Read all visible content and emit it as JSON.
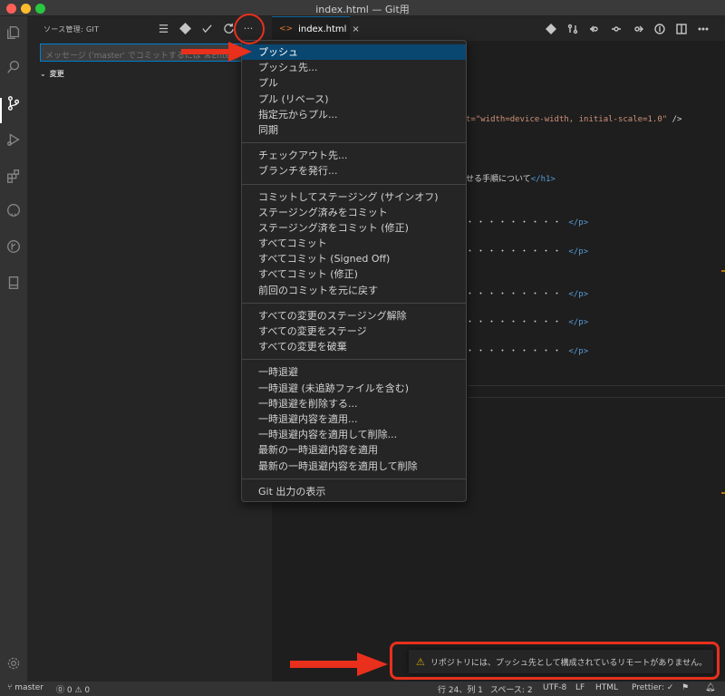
{
  "window": {
    "title": "index.html — Git用"
  },
  "sidebar": {
    "header": "ソース管理: GIT",
    "commit_placeholder": "メッセージ ('master' でコミットするには ⌘Enter)",
    "changes_label": "変更",
    "tool_more": "···"
  },
  "editor": {
    "tab": {
      "label": "index.html",
      "icon": "<>",
      "close": "×"
    },
    "code_lines": [
      {
        "type": "attr",
        "text": "t=\"width=device-width, initial-scale=1.0\"",
        "tail": " />"
      },
      {
        "type": "text",
        "text": "せる手順について",
        "tail": "</h1>"
      },
      {
        "type": "dots",
        "text": "・・・・・・・・・",
        "tail": " </p>"
      },
      {
        "type": "dots",
        "text": "・・・・・・・・・",
        "tail": " </p>"
      },
      {
        "type": "dots",
        "text": "・・・・・・・・・",
        "tail": " </p>"
      },
      {
        "type": "dots",
        "text": "・・・・・・・・・",
        "tail": " </p>"
      },
      {
        "type": "dots",
        "text": "・・・・・・・・・",
        "tail": " </p>"
      }
    ]
  },
  "menu": {
    "groups": [
      [
        "プッシュ",
        "プッシュ先...",
        "プル",
        "プル (リベース)",
        "指定元からプル...",
        "同期"
      ],
      [
        "チェックアウト先...",
        "ブランチを発行..."
      ],
      [
        "コミットしてステージング (サインオフ)",
        "ステージング済みをコミット",
        "ステージング済をコミット (修正)",
        "すべてコミット",
        "すべてコミット (Signed Off)",
        "すべてコミット (修正)",
        "前回のコミットを元に戻す"
      ],
      [
        "すべての変更のステージング解除",
        "すべての変更をステージ",
        "すべての変更を破棄"
      ],
      [
        "一時退避",
        "一時退避 (未追跡ファイルを含む)",
        "一時退避を削除する...",
        "一時退避内容を適用...",
        "一時退避内容を適用して削除...",
        "最新の一時退避内容を適用",
        "最新の一時退避内容を適用して削除"
      ],
      [
        "Git 出力の表示"
      ]
    ],
    "highlighted": "プッシュ"
  },
  "notification": {
    "icon": "warning-icon",
    "text": "リポジトリには、プッシュ先として構成されているリモートがありません。"
  },
  "statusbar": {
    "branch": "master",
    "problems": "⓪ 0 ⚠ 0",
    "position": "行 24、列 1",
    "spaces": "スペース: 2",
    "encoding": "UTF-8",
    "eol": "LF",
    "language": "HTML",
    "prettier": "Prettier: ✓"
  },
  "colors": {
    "accent": "#007fd4",
    "highlight": "#094771",
    "annotation": "#e8301c",
    "warning": "#cca700"
  }
}
